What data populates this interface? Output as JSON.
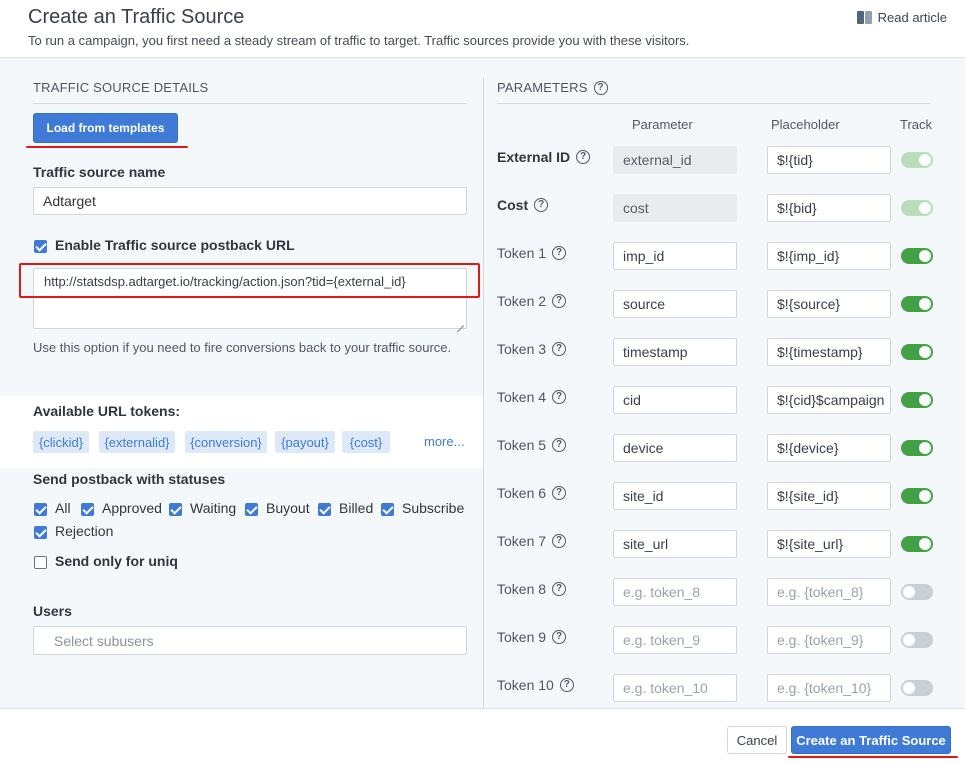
{
  "header": {
    "title": "Create an Traffic Source",
    "subtitle": "To run a campaign, you first need a steady stream of traffic to target. Traffic sources provide you with these visitors.",
    "read_article": "Read article"
  },
  "left": {
    "section_title": "TRAFFIC SOURCE DETAILS",
    "load_templates": "Load from templates",
    "name_label": "Traffic source name",
    "name_value": "Adtarget",
    "postback_enable_label": "Enable Traffic source postback URL",
    "postback_url": "http://statsdsp.adtarget.io/tracking/action.json?tid={external_id}",
    "postback_help": "Use this option if you need to fire conversions back to your traffic source.",
    "tokens_label": "Available URL tokens:",
    "tokens": [
      "{clickid}",
      "{externalid}",
      "{conversion}",
      "{payout}",
      "{cost}"
    ],
    "more": "more...",
    "statuses_label": "Send postback with statuses",
    "statuses": [
      "All",
      "Approved",
      "Waiting",
      "Buyout",
      "Billed",
      "Subscribe",
      "Rejection"
    ],
    "uniq_label": "Send only for uniq",
    "users_label": "Users",
    "users_placeholder": "Select subusers"
  },
  "right": {
    "section_title": "PARAMETERS",
    "col_parameter": "Parameter",
    "col_placeholder": "Placeholder",
    "col_track": "Track",
    "rows": [
      {
        "label": "External ID",
        "param": "external_id",
        "placeholder": "$!{tid}",
        "track": "on-dim"
      },
      {
        "label": "Cost",
        "param": "cost",
        "placeholder": "$!{bid}",
        "track": "on-dim"
      },
      {
        "label": "Token 1",
        "param": "imp_id",
        "placeholder": "$!{imp_id}",
        "track": "on"
      },
      {
        "label": "Token 2",
        "param": "source",
        "placeholder": "$!{source}",
        "track": "on"
      },
      {
        "label": "Token 3",
        "param": "timestamp",
        "placeholder": "$!{timestamp}",
        "track": "on"
      },
      {
        "label": "Token 4",
        "param": "cid",
        "placeholder": "$!{cid}$campaign",
        "track": "on"
      },
      {
        "label": "Token 5",
        "param": "device",
        "placeholder": "$!{device}",
        "track": "on"
      },
      {
        "label": "Token 6",
        "param": "site_id",
        "placeholder": "$!{site_id}",
        "track": "on"
      },
      {
        "label": "Token 7",
        "param": "site_url",
        "placeholder": "$!{site_url}",
        "track": "on"
      },
      {
        "label": "Token 8",
        "param_hint": "e.g. token_8",
        "placeholder_hint": "e.g. {token_8}",
        "track": "off"
      },
      {
        "label": "Token 9",
        "param_hint": "e.g. token_9",
        "placeholder_hint": "e.g. {token_9}",
        "track": "off"
      },
      {
        "label": "Token 10",
        "param_hint": "e.g. token_10",
        "placeholder_hint": "e.g. {token_10}",
        "track": "off"
      }
    ]
  },
  "footer": {
    "cancel": "Cancel",
    "create": "Create an Traffic Source"
  },
  "colors": {
    "primary": "#3f7bd6",
    "toggle_on": "#43a047",
    "highlight_red": "#e01818"
  }
}
